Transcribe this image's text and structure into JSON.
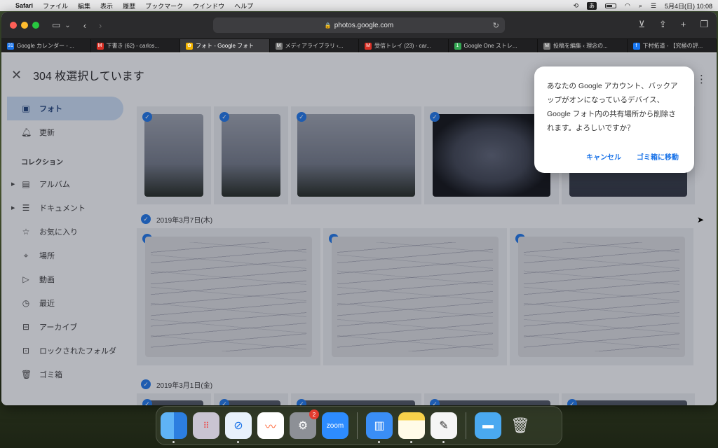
{
  "menubar": {
    "app": "Safari",
    "items": [
      "ファイル",
      "編集",
      "表示",
      "履歴",
      "ブックマーク",
      "ウインドウ",
      "ヘルプ"
    ],
    "ime": "あ",
    "datetime": "5月4日(日)  10:08"
  },
  "browser": {
    "url": "photos.google.com",
    "tabs": [
      {
        "label": "Google カレンダー - ...",
        "fav": "31",
        "color": "#1a73e8"
      },
      {
        "label": "下書き (62) - carlos...",
        "fav": "M",
        "color": "#d93025"
      },
      {
        "label": "フォト - Google フォト",
        "fav": "✿",
        "color": "#f4b400",
        "active": true
      },
      {
        "label": "メディアライブラリ ‹...",
        "fav": "M",
        "color": "#777777"
      },
      {
        "label": "受信トレイ (23) - car...",
        "fav": "M",
        "color": "#d93025"
      },
      {
        "label": "Google One ストレ...",
        "fav": "1",
        "color": "#34a853"
      },
      {
        "label": "投稿を編集 ‹ 理念の...",
        "fav": "M",
        "color": "#777777"
      },
      {
        "label": "下村拓道 - 【究極の評...",
        "fav": "f",
        "color": "#1877f2"
      }
    ]
  },
  "header": {
    "title": "304 枚選択しています"
  },
  "sidebar": {
    "items": [
      {
        "label": "フォト",
        "icon": "photo-icon",
        "active": true
      },
      {
        "label": "更新",
        "icon": "bell-icon"
      }
    ],
    "section": "コレクション",
    "collections": [
      {
        "label": "アルバム",
        "icon": "album-icon",
        "expandable": true
      },
      {
        "label": "ドキュメント",
        "icon": "document-icon",
        "expandable": true
      },
      {
        "label": "お気に入り",
        "icon": "star-icon"
      },
      {
        "label": "場所",
        "icon": "location-icon"
      },
      {
        "label": "動画",
        "icon": "play-icon"
      },
      {
        "label": "最近",
        "icon": "clock-icon"
      },
      {
        "label": "アーカイブ",
        "icon": "archive-icon"
      },
      {
        "label": "ロックされたフォルダ",
        "icon": "lock-icon"
      },
      {
        "label": "ゴミ箱",
        "icon": "trash-icon"
      }
    ]
  },
  "groups": [
    {
      "date": "2019年3月7日(木)"
    },
    {
      "date": "2019年3月1日(金)"
    }
  ],
  "dialog": {
    "message": "あなたの Google アカウント、バックアップがオンになっているデバイス、Google フォト内の共有場所から削除されます。よろしいですか？",
    "cancel": "キャンセル",
    "confirm": "ゴミ箱に移動"
  },
  "dock": {
    "settings_badge": "2",
    "zoom_label": "zoom"
  }
}
